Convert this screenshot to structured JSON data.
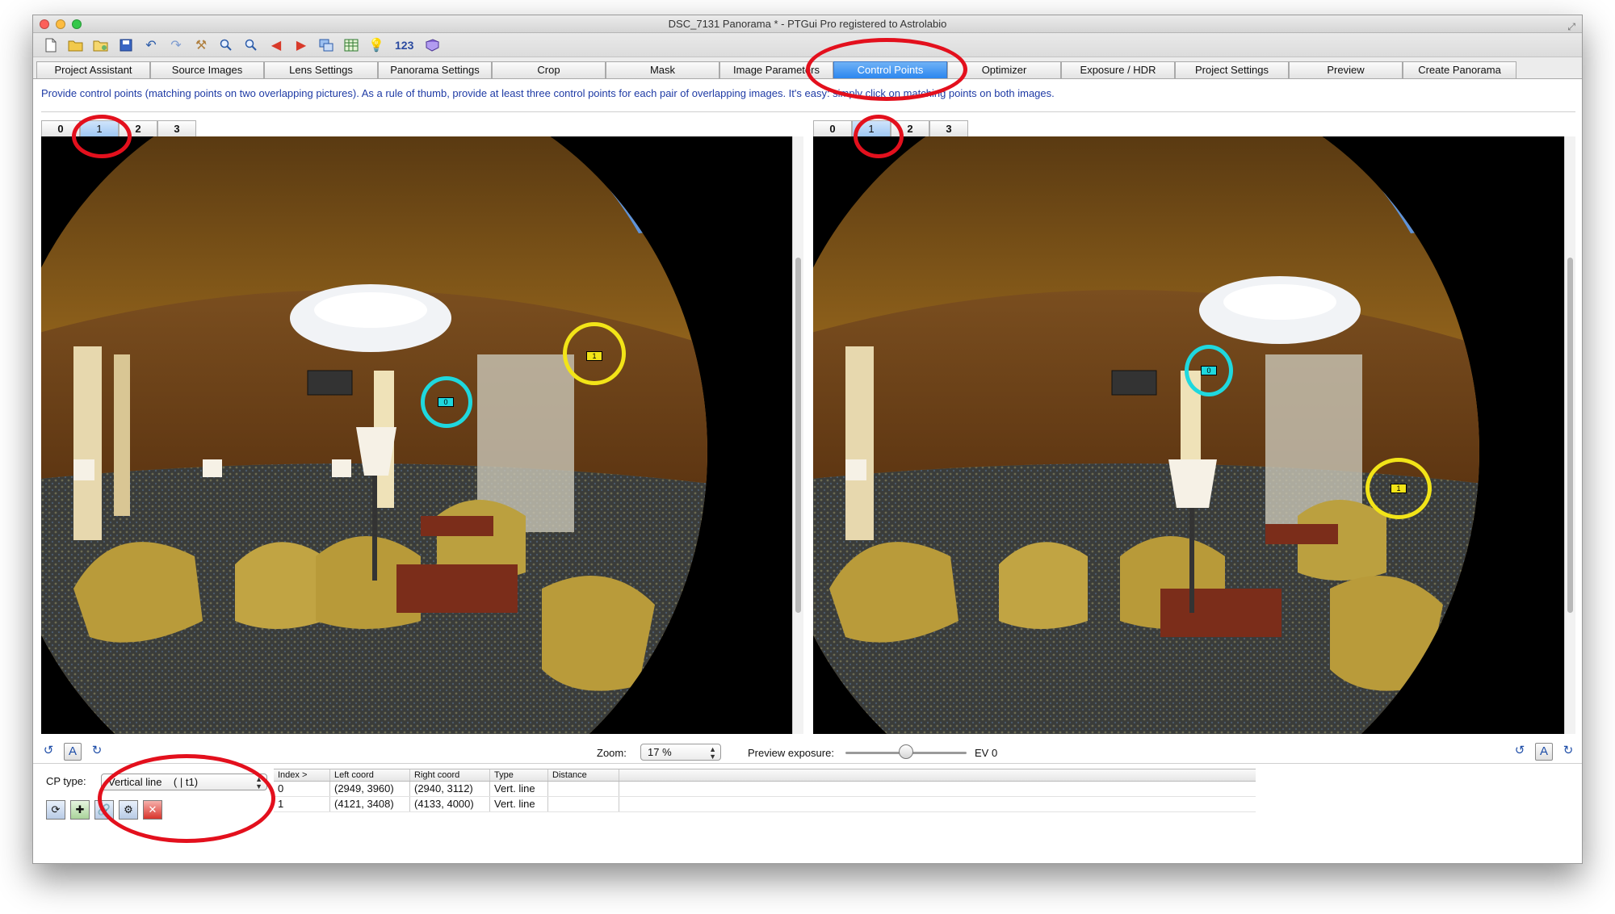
{
  "window": {
    "title": "DSC_7131 Panorama * - PTGui Pro registered to Astrolabio"
  },
  "toolbar": {
    "counter_label": "123"
  },
  "tabs": [
    {
      "label": "Project Assistant"
    },
    {
      "label": "Source Images"
    },
    {
      "label": "Lens Settings"
    },
    {
      "label": "Panorama Settings"
    },
    {
      "label": "Crop"
    },
    {
      "label": "Mask"
    },
    {
      "label": "Image Parameters"
    },
    {
      "label": "Control Points",
      "active": true
    },
    {
      "label": "Optimizer"
    },
    {
      "label": "Exposure / HDR"
    },
    {
      "label": "Project Settings"
    },
    {
      "label": "Preview"
    },
    {
      "label": "Create Panorama"
    }
  ],
  "instruction": "Provide control points (matching points on two overlapping pictures). As a rule of thumb, provide at least three control points for each pair of overlapping images. It's easy: simply click on matching points on both images.",
  "left_pane": {
    "image_tabs": [
      "0",
      "1",
      "2",
      "3"
    ],
    "selected": "1"
  },
  "right_pane": {
    "image_tabs": [
      "0",
      "1",
      "2",
      "3"
    ],
    "selected": "1"
  },
  "control_points": {
    "cp0_label": "0",
    "cp1_label": "1"
  },
  "zoom": {
    "label": "Zoom:",
    "value": "17 %"
  },
  "preview_exposure": {
    "label": "Preview exposure:",
    "value": "EV 0",
    "slider_fraction": 0.5
  },
  "cp_type": {
    "label": "CP type:",
    "value": "Vertical line    ( | t1)"
  },
  "table": {
    "headers": [
      "Index >",
      "Left coord",
      "Right coord",
      "Type",
      "Distance",
      ""
    ],
    "rows": [
      [
        "0",
        "(2949, 3960)",
        "(2940, 3112)",
        "Vert. line",
        "",
        ""
      ],
      [
        "1",
        "(4121, 3408)",
        "(4133, 4000)",
        "Vert. line",
        "",
        ""
      ]
    ]
  },
  "colors": {
    "accent_tab": "#2b86ef",
    "instruction_text": "#1f3ba5",
    "cp0": "#1fd8de",
    "cp1": "#f2e418",
    "annotation": "#e3101d"
  },
  "icons": [
    "new-file-icon",
    "open-folder-icon",
    "open-recent-icon",
    "save-icon",
    "undo-icon",
    "redo-icon",
    "tools-icon",
    "zoom-in-icon",
    "zoom-out-icon",
    "arrow-left-icon",
    "arrow-right-icon",
    "images-icon",
    "table-icon",
    "lightbulb-icon",
    "book-icon"
  ]
}
